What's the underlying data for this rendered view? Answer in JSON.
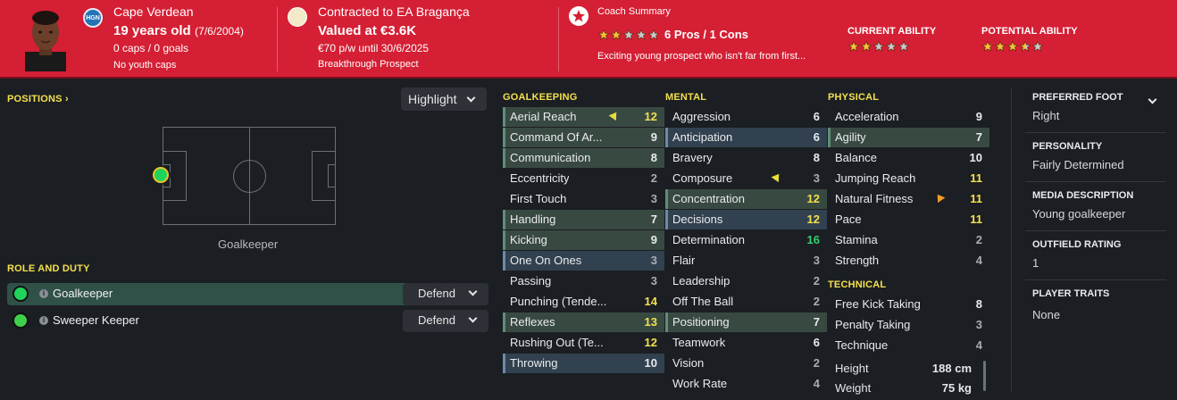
{
  "header": {
    "nationality": "Cape Verdean",
    "nation_code": "HGN",
    "age": "19 years old",
    "dob": "(7/6/2004)",
    "caps": "0 caps / 0 goals",
    "youth_caps": "No youth caps",
    "contract": "Contracted to EA Bragança",
    "value": "Valued at €3.6K",
    "wage": "€70 p/w until 30/6/2025",
    "status": "Breakthrough Prospect",
    "coach_title": "Coach Summary",
    "pros_cons": "6 Pros / 1 Cons",
    "coach_summary": "Exciting young prospect who isn't far from first...",
    "coach_stars": 2,
    "current_ability_label": "CURRENT ABILITY",
    "current_ability_stars": 2,
    "potential_ability_label": "POTENTIAL ABILITY",
    "potential_ability_stars": 3.5
  },
  "positions": {
    "label": "POSITIONS ›",
    "highlight_label": "Highlight",
    "position_caption": "Goalkeeper"
  },
  "role_duty": {
    "label": "ROLE AND DUTY",
    "roles": [
      {
        "name": "Goalkeeper",
        "duty": "Defend",
        "selected": true
      },
      {
        "name": "Sweeper Keeper",
        "duty": "Defend",
        "selected": false
      }
    ]
  },
  "attributes": {
    "goalkeeping": {
      "label": "GOALKEEPING",
      "items": [
        {
          "name": "Aerial Reach",
          "value": 12,
          "hl": "green",
          "arrow": "up"
        },
        {
          "name": "Command Of Ar...",
          "value": 9,
          "hl": "green"
        },
        {
          "name": "Communication",
          "value": 8,
          "hl": "green"
        },
        {
          "name": "Eccentricity",
          "value": 2,
          "hl": ""
        },
        {
          "name": "First Touch",
          "value": 3,
          "hl": ""
        },
        {
          "name": "Handling",
          "value": 7,
          "hl": "green"
        },
        {
          "name": "Kicking",
          "value": 9,
          "hl": "green"
        },
        {
          "name": "One On Ones",
          "value": 3,
          "hl": "blue"
        },
        {
          "name": "Passing",
          "value": 3,
          "hl": ""
        },
        {
          "name": "Punching (Tende...",
          "value": 14,
          "hl": ""
        },
        {
          "name": "Reflexes",
          "value": 13,
          "hl": "green"
        },
        {
          "name": "Rushing Out (Te...",
          "value": 12,
          "hl": ""
        },
        {
          "name": "Throwing",
          "value": 10,
          "hl": "blue"
        }
      ]
    },
    "mental": {
      "label": "MENTAL",
      "items": [
        {
          "name": "Aggression",
          "value": 6,
          "hl": ""
        },
        {
          "name": "Anticipation",
          "value": 6,
          "hl": "blue"
        },
        {
          "name": "Bravery",
          "value": 8,
          "hl": ""
        },
        {
          "name": "Composure",
          "value": 3,
          "hl": "",
          "arrow": "up"
        },
        {
          "name": "Concentration",
          "value": 12,
          "hl": "green"
        },
        {
          "name": "Decisions",
          "value": 12,
          "hl": "blue"
        },
        {
          "name": "Determination",
          "value": 16,
          "hl": ""
        },
        {
          "name": "Flair",
          "value": 3,
          "hl": ""
        },
        {
          "name": "Leadership",
          "value": 2,
          "hl": ""
        },
        {
          "name": "Off The Ball",
          "value": 2,
          "hl": ""
        },
        {
          "name": "Positioning",
          "value": 7,
          "hl": "green"
        },
        {
          "name": "Teamwork",
          "value": 6,
          "hl": ""
        },
        {
          "name": "Vision",
          "value": 2,
          "hl": ""
        },
        {
          "name": "Work Rate",
          "value": 4,
          "hl": ""
        }
      ]
    },
    "physical": {
      "label": "PHYSICAL",
      "items": [
        {
          "name": "Acceleration",
          "value": 9,
          "hl": ""
        },
        {
          "name": "Agility",
          "value": 7,
          "hl": "green"
        },
        {
          "name": "Balance",
          "value": 10,
          "hl": ""
        },
        {
          "name": "Jumping Reach",
          "value": 11,
          "hl": ""
        },
        {
          "name": "Natural Fitness",
          "value": 11,
          "hl": "",
          "arrow": "orange"
        },
        {
          "name": "Pace",
          "value": 11,
          "hl": ""
        },
        {
          "name": "Stamina",
          "value": 2,
          "hl": ""
        },
        {
          "name": "Strength",
          "value": 4,
          "hl": ""
        }
      ]
    },
    "technical": {
      "label": "TECHNICAL",
      "items": [
        {
          "name": "Free Kick Taking",
          "value": 8,
          "hl": ""
        },
        {
          "name": "Penalty Taking",
          "value": 3,
          "hl": ""
        },
        {
          "name": "Technique",
          "value": 4,
          "hl": ""
        }
      ]
    },
    "body": {
      "height_label": "Height",
      "height": "188 cm",
      "weight_label": "Weight",
      "weight": "75 kg"
    }
  },
  "profile": {
    "preferred_foot_label": "PREFERRED FOOT",
    "preferred_foot": "Right",
    "personality_label": "PERSONALITY",
    "personality": "Fairly Determined",
    "media_label": "MEDIA DESCRIPTION",
    "media": "Young goalkeeper",
    "outfield_label": "OUTFIELD RATING",
    "outfield": "1",
    "traits_label": "PLAYER TRAITS",
    "traits": "None"
  },
  "colors": {
    "header_red": "#d51f34",
    "section_yellow": "#f4e04d",
    "top_value_green": "#35d16b",
    "row_green": "#384942",
    "row_blue": "#32414f"
  }
}
